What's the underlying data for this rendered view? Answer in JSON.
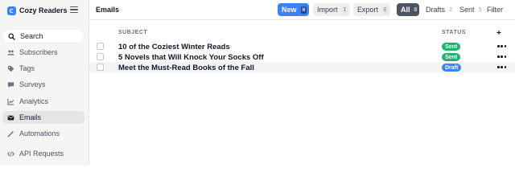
{
  "app": {
    "name": "Cozy Readers"
  },
  "sidebar": {
    "search_label": "Search",
    "items": [
      {
        "label": "Subscribers",
        "icon": "users-icon"
      },
      {
        "label": "Tags",
        "icon": "tag-icon"
      },
      {
        "label": "Surveys",
        "icon": "chat-bubble-icon"
      },
      {
        "label": "Analytics",
        "icon": "chart-icon"
      },
      {
        "label": "Emails",
        "icon": "envelope-icon",
        "active": true
      },
      {
        "label": "Automations",
        "icon": "magic-wand-icon"
      },
      {
        "label": "API Requests",
        "icon": "code-icon"
      }
    ]
  },
  "header": {
    "title": "Emails",
    "new_label": "New",
    "new_key": "N",
    "import_label": "Import",
    "import_key": "I",
    "export_label": "Export",
    "export_key": "E",
    "filter_label": "Filter"
  },
  "tabs": [
    {
      "label": "All",
      "count": "8",
      "active": true
    },
    {
      "label": "Drafts",
      "count": "2"
    },
    {
      "label": "Sent",
      "count": "5"
    }
  ],
  "table": {
    "col_subject": "SUBJECT",
    "col_status": "STATUS",
    "add_column": "+",
    "rows": [
      {
        "subject": "10 of the Coziest Winter Reads",
        "status": "Sent"
      },
      {
        "subject": "5 Novels that Will Knock Your Socks Off",
        "status": "Sent"
      },
      {
        "subject": "Meet the Must-Read Books of the Fall",
        "status": "Draft"
      }
    ]
  },
  "colors": {
    "accent": "#3b82f6",
    "sent_badge": "#22b36b",
    "draft_badge": "#3b82f6",
    "active_tab": "#4b5563"
  }
}
